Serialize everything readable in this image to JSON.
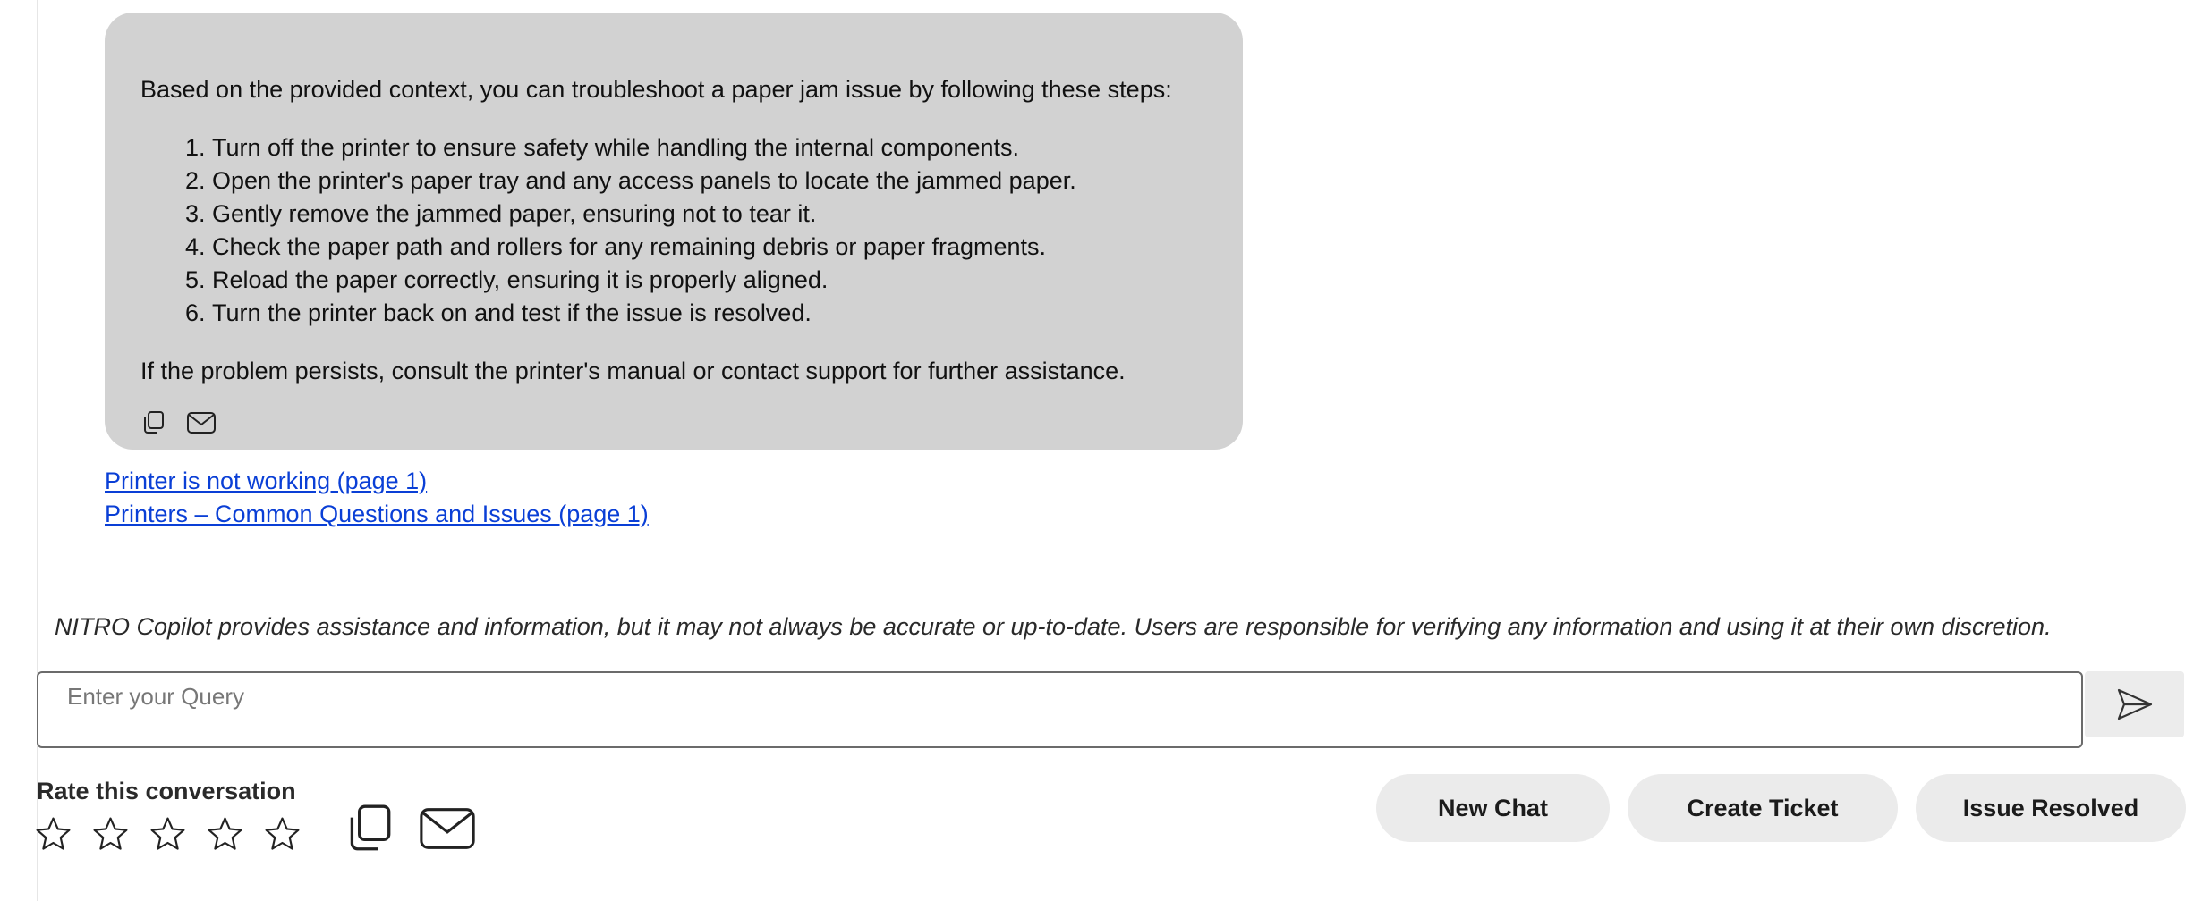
{
  "message": {
    "intro": "Based on the provided context, you can troubleshoot a paper jam issue by following these steps:",
    "steps": [
      "Turn off the printer to ensure safety while handling the internal components.",
      "Open the printer's paper tray and any access panels to locate the jammed paper.",
      "Gently remove the jammed paper, ensuring not to tear it.",
      "Check the paper path and rollers for any remaining debris or paper fragments.",
      "Reload the paper correctly, ensuring it is properly aligned.",
      "Turn the printer back on and test if the issue is resolved."
    ],
    "outro": "If the problem persists, consult the printer's manual or contact support for further assistance.",
    "action_icons": [
      "copy-icon",
      "mail-icon"
    ]
  },
  "sources": [
    "Printer is not working (page 1)",
    "Printers – Common Questions and Issues (page 1)"
  ],
  "disclaimer": "NITRO Copilot provides assistance and information, but it may not always be accurate or up-to-date. Users are responsible for verifying any information and using it at their own discretion.",
  "query": {
    "placeholder": "Enter your Query",
    "value": "",
    "send_icon": "send-icon"
  },
  "rating": {
    "label": "Rate this conversation",
    "max_stars": 5,
    "selected": 0,
    "star_icon": "star-outline-icon"
  },
  "conversation_icons": [
    "copy-icon",
    "mail-icon"
  ],
  "buttons": {
    "new_chat": "New Chat",
    "create_ticket": "Create Ticket",
    "issue_resolved": "Issue Resolved"
  },
  "colors": {
    "bubble_bg": "#d2d2d2",
    "link": "#0a3fd6",
    "button_bg": "#ebebeb",
    "send_bg": "#ececec"
  }
}
